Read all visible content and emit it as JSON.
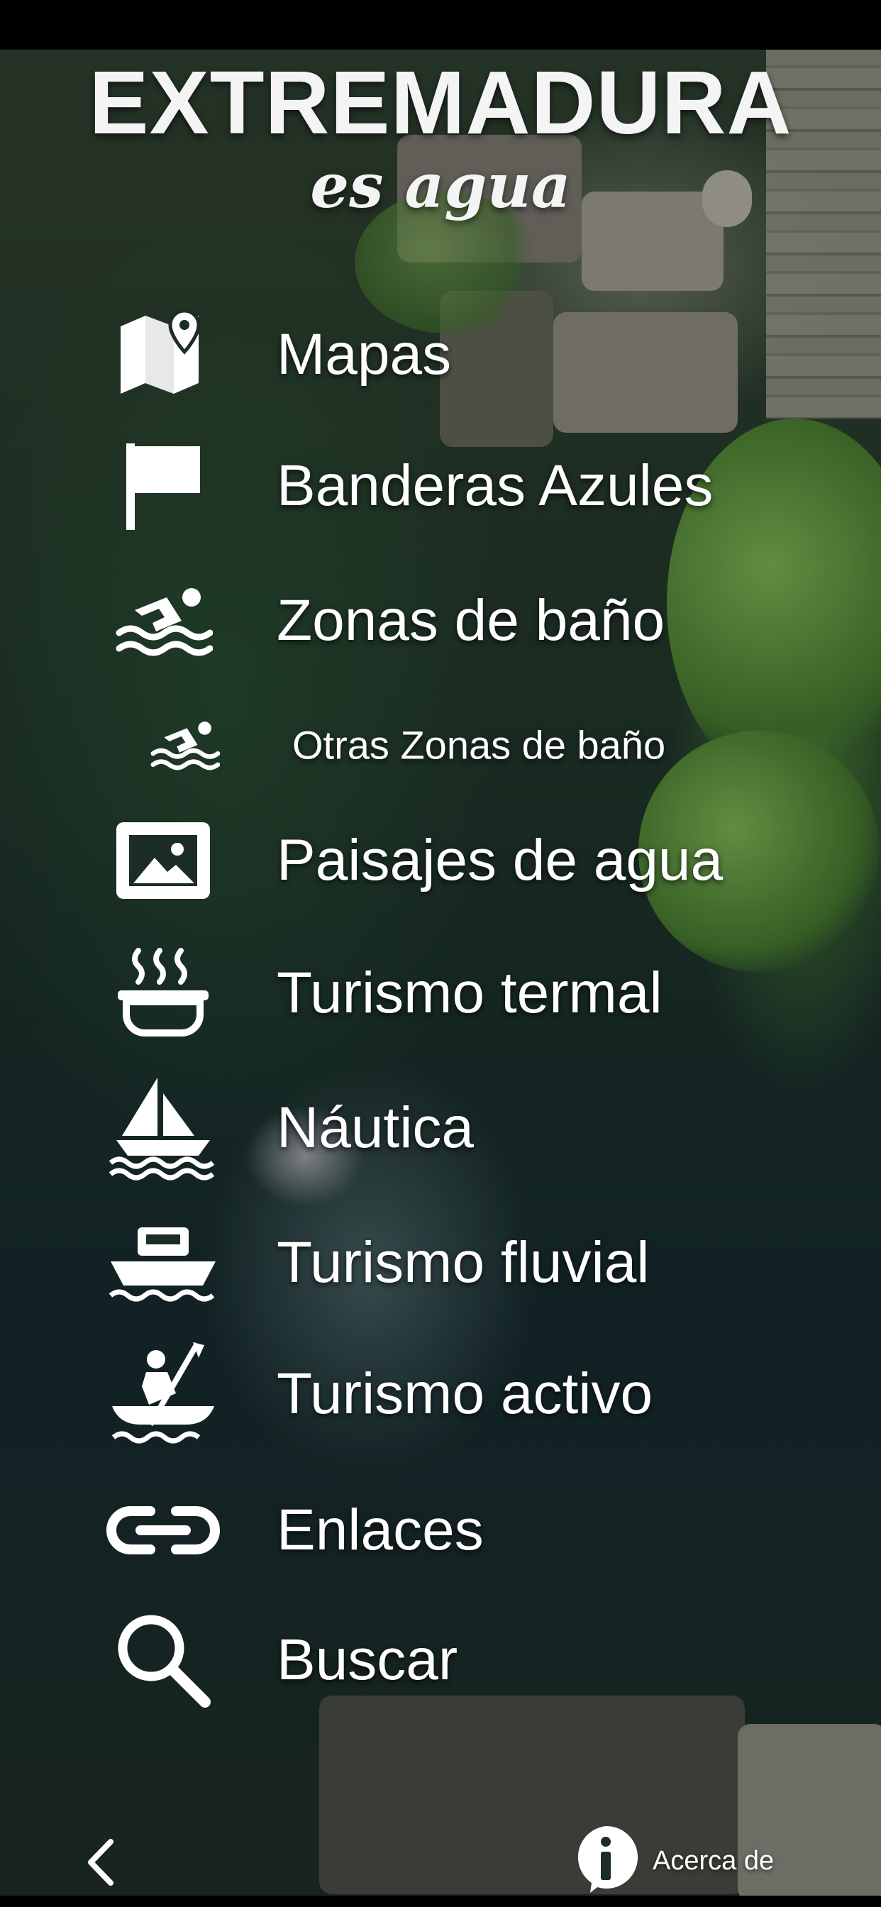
{
  "header": {
    "title": "EXTREMADURA",
    "subtitle": "es agua"
  },
  "menu": {
    "items": [
      {
        "label": "Mapas",
        "icon": "map-pin-icon"
      },
      {
        "label": "Banderas Azules",
        "icon": "flag-icon"
      },
      {
        "label": "Zonas de baño",
        "icon": "swimmer-icon"
      },
      {
        "label": "Otras Zonas de baño",
        "icon": "swimmer-small-icon"
      },
      {
        "label": "Paisajes de agua",
        "icon": "landscape-image-icon"
      },
      {
        "label": "Turismo termal",
        "icon": "hot-bath-icon"
      },
      {
        "label": "Náutica",
        "icon": "sailboat-icon"
      },
      {
        "label": "Turismo fluvial",
        "icon": "river-boat-icon"
      },
      {
        "label": "Turismo activo",
        "icon": "kayak-icon"
      },
      {
        "label": "Enlaces",
        "icon": "link-icon"
      },
      {
        "label": "Buscar",
        "icon": "search-icon"
      }
    ]
  },
  "footer": {
    "back_icon": "chevron-left-icon",
    "about_label": "Acerca de",
    "about_icon": "info-icon"
  },
  "colors": {
    "text": "#ffffff",
    "background_water": "#1b2e26"
  }
}
